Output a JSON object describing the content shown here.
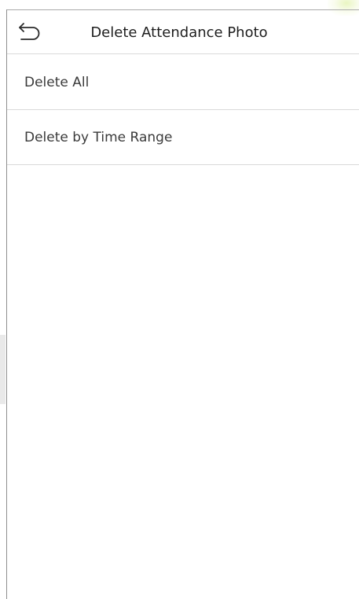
{
  "header": {
    "title": "Delete Attendance Photo",
    "back_icon": "back-arrow-icon"
  },
  "menu": {
    "items": [
      {
        "label": "Delete All"
      },
      {
        "label": "Delete by Time Range"
      }
    ]
  }
}
